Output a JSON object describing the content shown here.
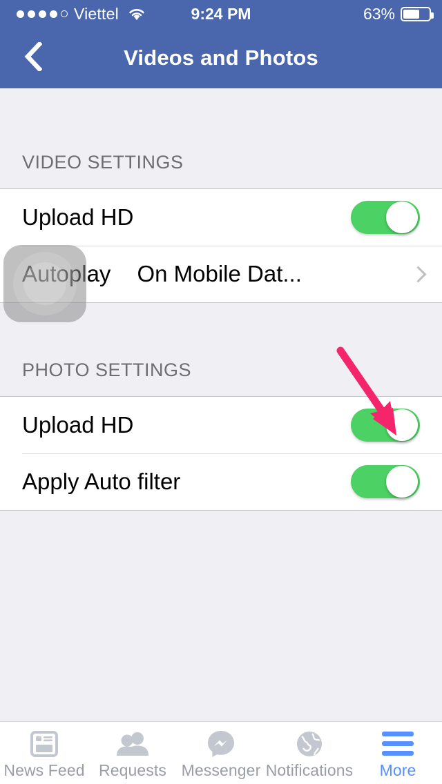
{
  "status_bar": {
    "signal_dots_filled": 4,
    "signal_dots_total": 5,
    "carrier": "Viettel",
    "wifi_icon": "wifi-icon",
    "time": "9:24 PM",
    "battery_percent": "63%",
    "battery_level": 63
  },
  "navbar": {
    "back_icon": "chevron-left-icon",
    "title": "Videos and Photos",
    "background_color": "#4A67AD"
  },
  "sections": [
    {
      "header": "VIDEO SETTINGS",
      "rows": [
        {
          "label": "Upload HD",
          "control": "toggle",
          "value": "on"
        },
        {
          "label": "Autoplay",
          "control": "disclosure",
          "value": "On Mobile Dat...",
          "chevron_icon": "chevron-right-icon"
        }
      ]
    },
    {
      "header": "PHOTO SETTINGS",
      "rows": [
        {
          "label": "Upload HD",
          "control": "toggle",
          "value": "on"
        },
        {
          "label": "Apply Auto filter",
          "control": "toggle",
          "value": "on"
        }
      ]
    }
  ],
  "annotations": {
    "arrow": {
      "color": "#F4256A",
      "target": "photo-upload-hd-toggle"
    },
    "tap_indicator": {
      "target": "autoplay-row",
      "color": "#8C8C8C"
    }
  },
  "colors": {
    "accent_blue": "#5890FF",
    "toggle_on": "#4CD264",
    "background": "#EFEFF4",
    "row_background": "#FFFFFF",
    "section_header_text": "#6D6D72",
    "tab_inactive": "#C3C7CF"
  },
  "tabbar": {
    "items": [
      {
        "label": "News Feed",
        "icon": "news-feed-icon",
        "active": false
      },
      {
        "label": "Requests",
        "icon": "friend-requests-icon",
        "active": false
      },
      {
        "label": "Messenger",
        "icon": "messenger-icon",
        "active": false
      },
      {
        "label": "Notifications",
        "icon": "notifications-globe-icon",
        "active": false
      },
      {
        "label": "More",
        "icon": "hamburger-menu-icon",
        "active": true
      }
    ]
  }
}
